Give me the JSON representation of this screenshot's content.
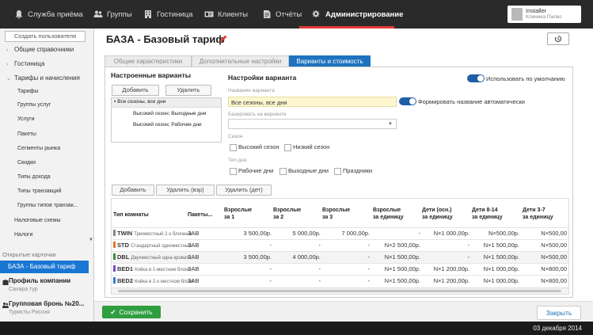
{
  "topnav": {
    "items": [
      {
        "label": "Служба приёма",
        "icon": "bell-icon"
      },
      {
        "label": "Группы",
        "icon": "group-icon"
      },
      {
        "label": "Гостиница",
        "icon": "building-icon"
      },
      {
        "label": "Клиенты",
        "icon": "id-card-icon"
      },
      {
        "label": "Отчёты",
        "icon": "report-icon"
      },
      {
        "label": "Администрирование",
        "icon": "gears-icon"
      }
    ],
    "active_index": 5,
    "accent_color": "#e53935"
  },
  "user": {
    "name": "Installer",
    "subtitle": "Клиника Палас"
  },
  "sidebar": {
    "create_user": "Создать пользователя",
    "groups": [
      {
        "label": "Общие справочники",
        "chevron": "›"
      },
      {
        "label": "Гостиница",
        "chevron": "›"
      },
      {
        "label": "Тарифы и начисления",
        "chevron": "⌄"
      }
    ],
    "sub_items": [
      "Тарифы",
      "Группы услуг",
      "Услуги",
      "Пакеты",
      "Сегменты рынка",
      "Скидки",
      "Типы дохода",
      "Типы транзакций",
      "Группы типов транзак...",
      "Налоговые схемы"
    ],
    "taxes": "Налоги",
    "open_cards_label": "Открытые карточки",
    "active_card": "БАЗА - Базовый тариф",
    "cards": [
      {
        "title": "Профиль компании",
        "subtitle": "Сахара тур"
      },
      {
        "title": "Групповая бронь №20...",
        "subtitle": "Туристы Россия"
      }
    ]
  },
  "main": {
    "title": "БАЗА - Базовый тариф",
    "tabs": [
      "Общие характеристики",
      "Дополнительные настройки",
      "Варианты и стоимость"
    ],
    "active_tab": 2
  },
  "variants": {
    "header": "Настроенные варианты",
    "add": "Добавить",
    "delete": "Удалить",
    "tree": [
      "Все сезоны, все дни",
      "Высокий сезон; Выходные дни",
      "Высокий сезон; Рабочие дни"
    ]
  },
  "settings": {
    "header": "Настройки варианта",
    "use_default": "Использовать по умолчанию",
    "name_label": "Название варианта",
    "name_value": "Все сезоны, все дни",
    "auto_name": "Формировать название автоматически",
    "base_label": "Базировать на варианте",
    "season_label": "Сезон",
    "seasons": [
      "Высокий сезон",
      "Низкий сезон"
    ],
    "daytype_label": "Тип дня",
    "daytypes": [
      "Рабочие дни",
      "Выходные дни",
      "Праздники"
    ]
  },
  "grid": {
    "buttons": [
      "Добавить",
      "Удалить (взр)",
      "Удалить (дет)"
    ],
    "columns": [
      [
        "Тип комнаты",
        ""
      ],
      [
        "Пакеты...",
        ""
      ],
      [
        "Взрослые",
        "за 1"
      ],
      [
        "Взрослые",
        "за 2"
      ],
      [
        "Взрослые",
        "за 3"
      ],
      [
        "Взрослые",
        "за единицу"
      ],
      [
        "Дети (осн.)",
        "за единицу"
      ],
      [
        "Дети 8-14",
        "за единицу"
      ],
      [
        "Дети 3-7",
        "за единицу"
      ]
    ],
    "rows": [
      {
        "code": "TWIN",
        "desc": "Трехместный 2-х блочный",
        "color": "#888888",
        "pkg": "ЗАВ",
        "v": [
          "3 500,00р.",
          "5 000,00р.",
          "7 000,00р.",
          "-",
          "N×1 000,00р.",
          "N×500,00р.",
          "N×500,00"
        ]
      },
      {
        "code": "STD",
        "desc": "Стандартный одноместный",
        "color": "#e07a2a",
        "pkg": "ЗАВ",
        "v": [
          "-",
          "-",
          "-",
          "N×2 500,00р.",
          "-",
          "N×1 500,00р.",
          "N×500,00"
        ]
      },
      {
        "code": "DBL",
        "desc": "Двухместный одна кровать",
        "color": "#3c8f3c",
        "pkg": "ЗАВ",
        "v": [
          "3 500,00р.",
          "4 000,00р.",
          "-",
          "N×1 500,00р.",
          "-",
          "N×1 500,00р.",
          "N×500,00"
        ]
      },
      {
        "code": "BED1",
        "desc": "Койка в 1-местном блоке",
        "color": "#7a4bc2",
        "pkg": "ЗАВ",
        "v": [
          "-",
          "-",
          "-",
          "N×1 500,00р.",
          "N×1 200,00р.",
          "N×1 000,00р.",
          "N×800,00"
        ]
      },
      {
        "code": "BED2",
        "desc": "Койка в 2-х местном блоке",
        "color": "#3a7bd5",
        "pkg": "ЗАВ",
        "v": [
          "-",
          "-",
          "-",
          "N×1 500,00р.",
          "N×1 200,00р.",
          "N×1 000,00р.",
          "N×800,00"
        ]
      }
    ]
  },
  "footer": {
    "save": "Сохранить",
    "close": "Закрыть",
    "date": "03 декабря 2014",
    "save_color": "#2e9e3e"
  }
}
